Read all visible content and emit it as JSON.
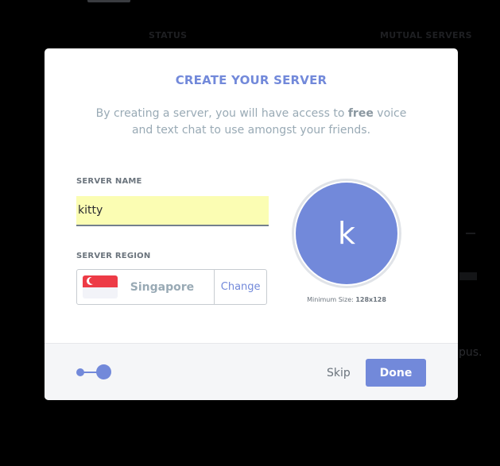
{
  "background": {
    "status_header": "STATUS",
    "mutual_header": "MUTUAL SERVERS",
    "fragment_text": "pus."
  },
  "modal": {
    "title": "CREATE YOUR SERVER",
    "description_before": "By creating a server, you will have access to ",
    "description_bold": "free",
    "description_after": " voice and text chat to use amongst your friends.",
    "server_name_label": "SERVER NAME",
    "server_name_value": "kitty",
    "server_region_label": "SERVER REGION",
    "region_name": "Singapore",
    "region_change_label": "Change",
    "avatar_letter": "k",
    "avatar_hint_prefix": "Minimum Size: ",
    "avatar_hint_size": "128x128",
    "skip_label": "Skip",
    "done_label": "Done"
  },
  "colors": {
    "accent": "#7289da",
    "input_bg": "#fbfdb3",
    "flag_red": "#ed3b46"
  },
  "icons": {
    "flag": "singapore-flag-icon",
    "progress": "step-progress-icon"
  }
}
